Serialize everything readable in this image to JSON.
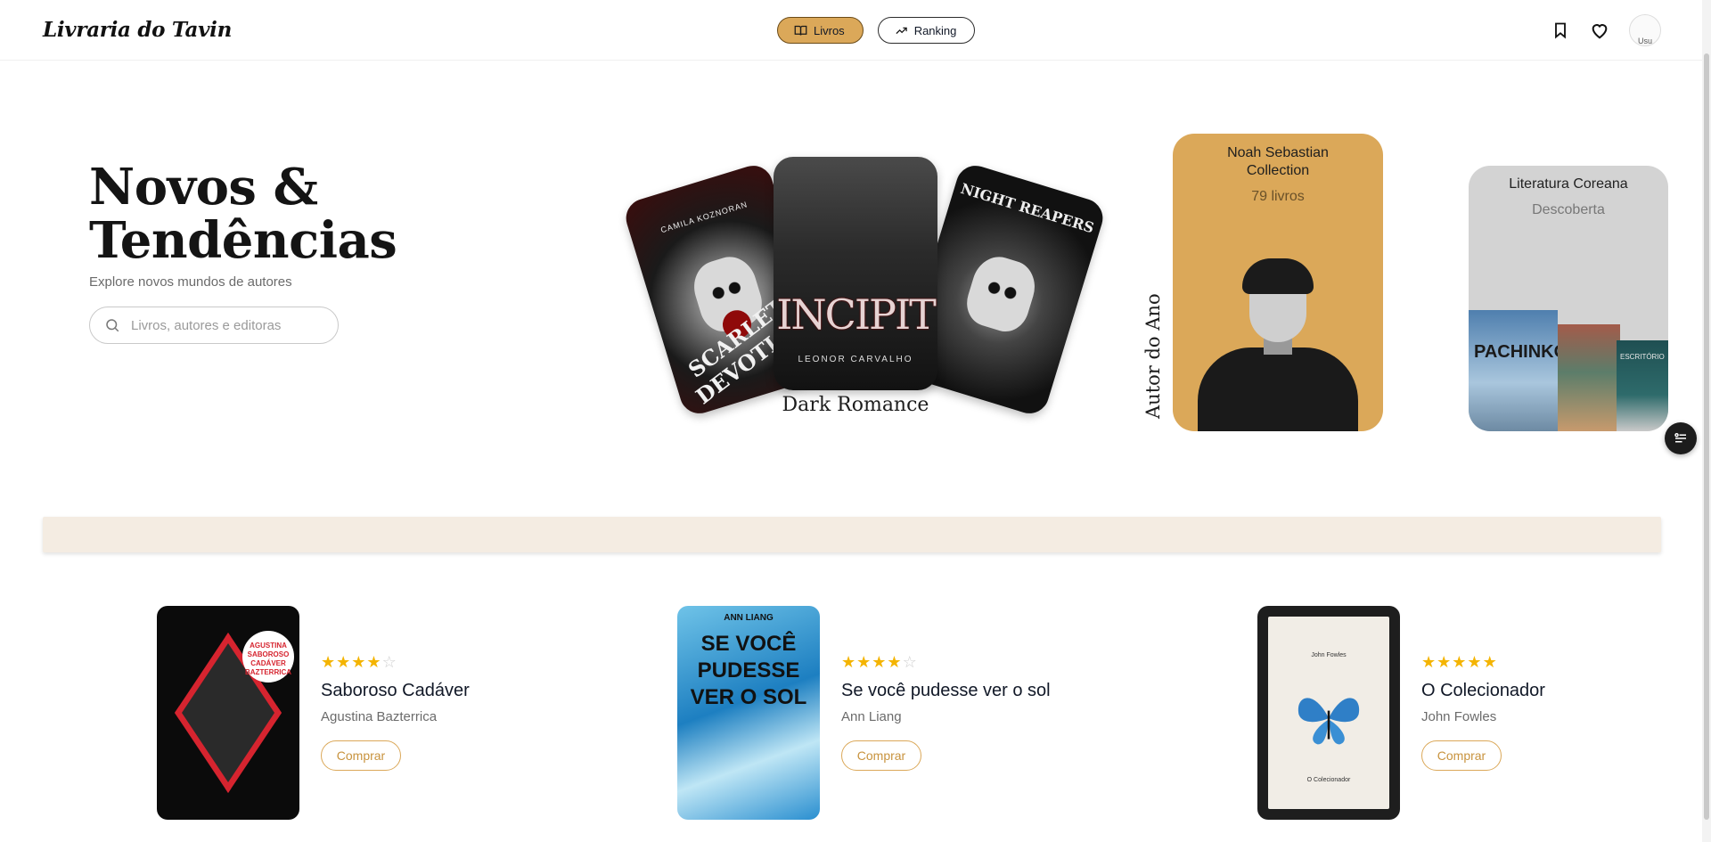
{
  "header": {
    "brand": "Livraria do Tavin",
    "nav": [
      {
        "label": "Livros",
        "active": true,
        "icon": "book-open-icon"
      },
      {
        "label": "Ranking",
        "active": false,
        "icon": "trending-up-icon"
      }
    ],
    "avatar_alt": "Usu",
    "icons": [
      "bookmark-icon",
      "heart-icon"
    ]
  },
  "hero": {
    "title_line1": "Novos &",
    "title_line2": "Tendências",
    "subtitle": "Explore novos mundos de autores",
    "search_placeholder": "Livros, autores e editoras"
  },
  "featured": {
    "dark_romance": {
      "label": "Dark Romance",
      "covers": [
        {
          "title": "SCARLET DEVOTION",
          "author": "CAMILA KOZNORAN"
        },
        {
          "title": "INCIPIT",
          "author": "LEONOR CARVALHO"
        },
        {
          "title": "NIGHT REAPERS",
          "author": ""
        }
      ]
    },
    "author_of_year": {
      "vertical_label": "Autor do Ano",
      "name": "Noah Sebastian Collection",
      "count": "79 livros"
    },
    "korean": {
      "title": "Literatura Coreana",
      "subtitle": "Descoberta",
      "covers": [
        {
          "title": "PACHINKO"
        },
        {
          "title": ""
        },
        {
          "title": "ESCRITÓRIO"
        }
      ]
    }
  },
  "books": [
    {
      "title": "Saboroso Cadáver",
      "author": "Agustina Bazterrica",
      "rating": 4,
      "buy_label": "Comprar",
      "cover_text": "AGUSTINA SABOROSO CADÁVER BAZTERRICA"
    },
    {
      "title": "Se você pudesse ver o sol",
      "author": "Ann Liang",
      "rating": 4,
      "buy_label": "Comprar",
      "cover_text": "SE VOCÊ PUDESSE VER O SOL",
      "cover_author": "ANN LIANG"
    },
    {
      "title": "O Colecionador",
      "author": "John Fowles",
      "rating": 5,
      "buy_label": "Comprar",
      "cover_author": "John Fowles",
      "cover_text": "O Colecionador"
    }
  ],
  "colors": {
    "accent": "#dba859",
    "banner": "#f4ece2",
    "star": "#f4b400"
  }
}
